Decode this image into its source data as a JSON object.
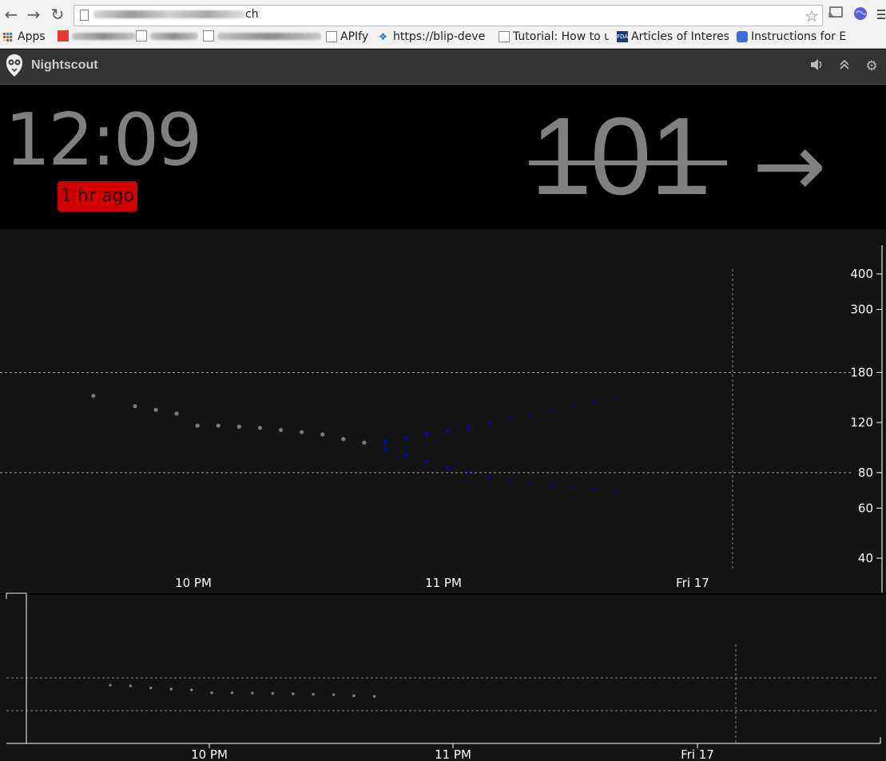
{
  "browser": {
    "url_suffix": "ch",
    "bookmarks": [
      {
        "label": "Apps"
      },
      {
        "label": "APIfy"
      },
      {
        "label": "https://blip-deve"
      },
      {
        "label": "Tutorial: How to u"
      },
      {
        "label": "Articles of Interes"
      },
      {
        "label": "Instructions for E"
      }
    ]
  },
  "app": {
    "title": "Nightscout"
  },
  "status": {
    "time": "12:09",
    "ago": "1 hr ago",
    "bg": "101",
    "direction": "→"
  },
  "colors": {
    "history_points": "#7a7a7a",
    "forecast_points": "#0000ff",
    "badge_red": "#d00000"
  },
  "chart_data": [
    {
      "type": "scatter",
      "title": "",
      "y_scale": "log",
      "ylim": [
        35,
        450
      ],
      "y_ticks": [
        400,
        300,
        180,
        120,
        80,
        60,
        40
      ],
      "target_lines": [
        180,
        80
      ],
      "x_ticks": [
        "10 PM",
        "11 PM",
        "Fri 17"
      ],
      "series": [
        {
          "values": [
            {
              "t": "21:36",
              "y": 149
            },
            {
              "t": "21:46",
              "y": 137
            },
            {
              "t": "21:51",
              "y": 133
            },
            {
              "t": "21:56",
              "y": 129
            },
            {
              "t": "22:01",
              "y": 117
            },
            {
              "t": "22:06",
              "y": 117
            },
            {
              "t": "22:11",
              "y": 116
            },
            {
              "t": "22:16",
              "y": 115
            },
            {
              "t": "22:21",
              "y": 113
            },
            {
              "t": "22:26",
              "y": 111
            },
            {
              "t": "22:31",
              "y": 109
            },
            {
              "t": "22:36",
              "y": 105
            },
            {
              "t": "22:41",
              "y": 102
            }
          ]
        },
        {
          "values": [
            {
              "t": "22:46",
              "y": 103
            },
            {
              "t": "22:51",
              "y": 106
            },
            {
              "t": "22:56",
              "y": 109
            },
            {
              "t": "23:01",
              "y": 112
            },
            {
              "t": "23:06",
              "y": 115
            },
            {
              "t": "23:11",
              "y": 120
            },
            {
              "t": "23:16",
              "y": 124
            },
            {
              "t": "23:21",
              "y": 128
            },
            {
              "t": "23:26",
              "y": 133
            },
            {
              "t": "23:31",
              "y": 138
            },
            {
              "t": "23:36",
              "y": 143
            },
            {
              "t": "23:41",
              "y": 148
            },
            {
              "t": "22:46",
              "y": 97
            },
            {
              "t": "22:51",
              "y": 92
            },
            {
              "t": "22:56",
              "y": 88
            },
            {
              "t": "23:01",
              "y": 83
            },
            {
              "t": "23:06",
              "y": 80
            },
            {
              "t": "23:11",
              "y": 77
            },
            {
              "t": "23:16",
              "y": 75
            },
            {
              "t": "23:21",
              "y": 73
            },
            {
              "t": "23:26",
              "y": 72
            },
            {
              "t": "23:31",
              "y": 71
            },
            {
              "t": "23:36",
              "y": 70
            },
            {
              "t": "23:41",
              "y": 69
            }
          ]
        }
      ]
    },
    {
      "type": "scatter",
      "title": "",
      "x_ticks": [
        "10 PM",
        "11 PM",
        "Fri 17"
      ],
      "series": [
        {
          "values": [
            {
              "t": "21:36",
              "y": 149
            },
            {
              "t": "21:41",
              "y": 146
            },
            {
              "t": "21:46",
              "y": 137
            },
            {
              "t": "21:51",
              "y": 133
            },
            {
              "t": "21:56",
              "y": 129
            },
            {
              "t": "22:01",
              "y": 117
            },
            {
              "t": "22:06",
              "y": 117
            },
            {
              "t": "22:11",
              "y": 116
            },
            {
              "t": "22:16",
              "y": 115
            },
            {
              "t": "22:21",
              "y": 113
            },
            {
              "t": "22:26",
              "y": 111
            },
            {
              "t": "22:31",
              "y": 109
            },
            {
              "t": "22:36",
              "y": 105
            },
            {
              "t": "22:41",
              "y": 102
            }
          ]
        }
      ]
    }
  ]
}
